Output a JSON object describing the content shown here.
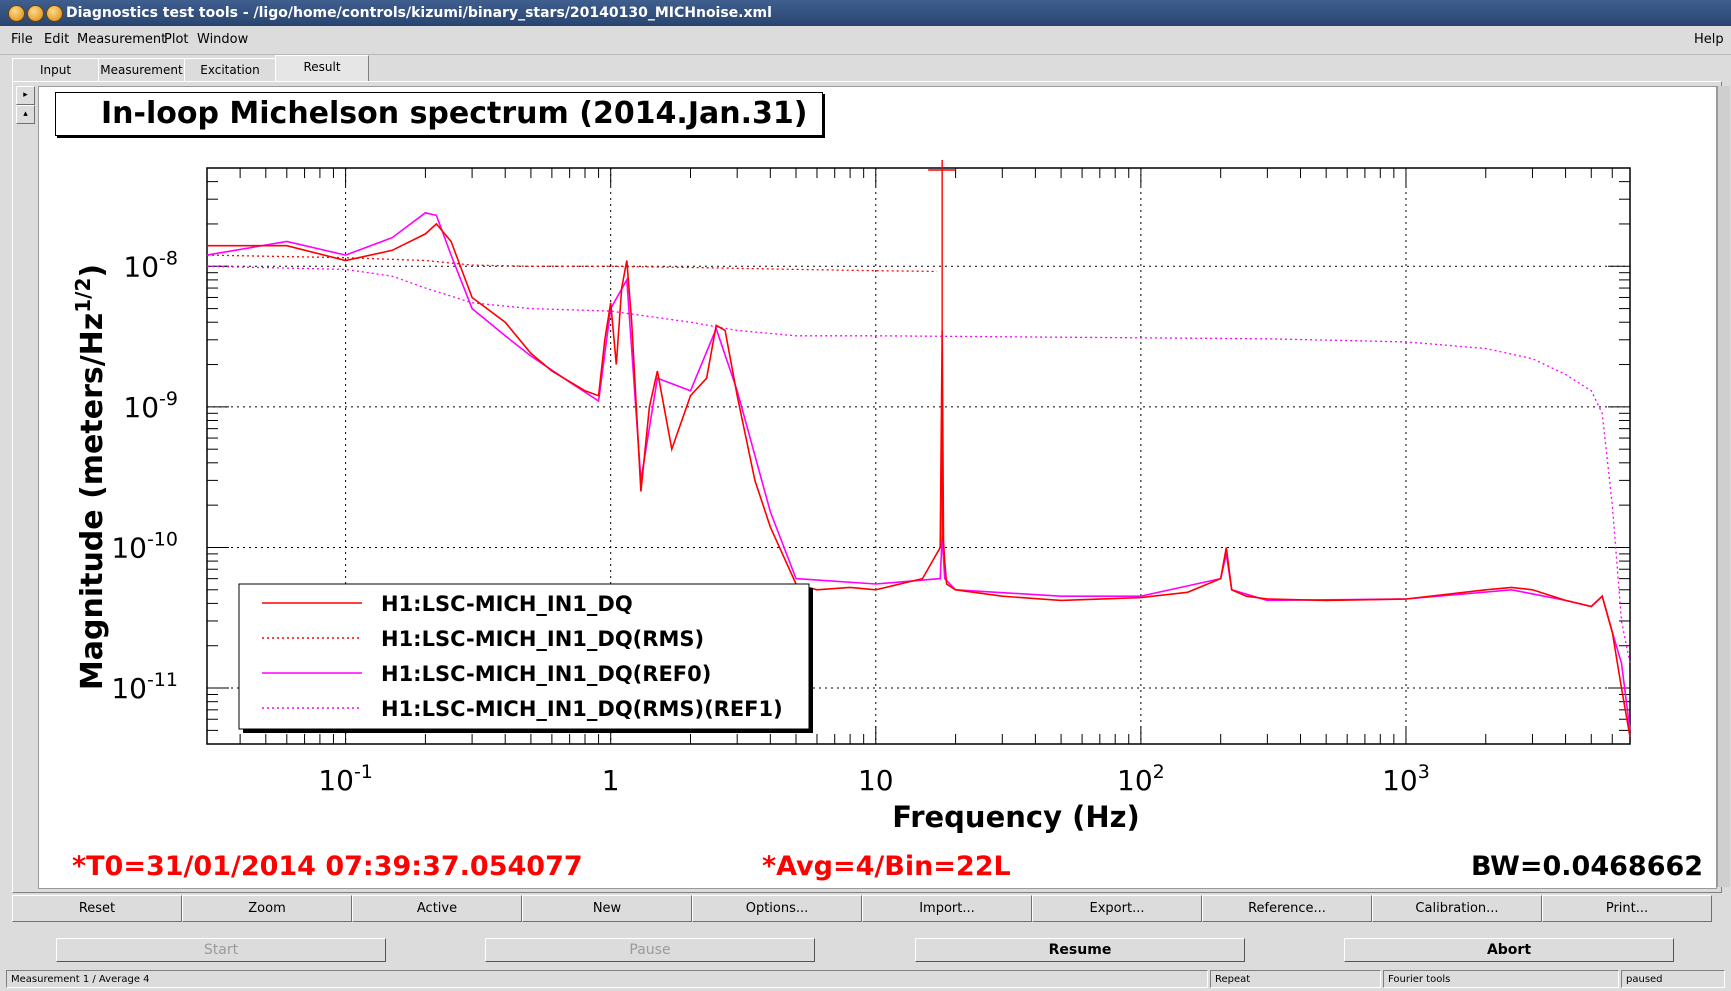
{
  "window": {
    "title": "Diagnostics test tools - /ligo/home/controls/kizumi/binary_stars/20140130_MICHnoise.xml"
  },
  "menu": {
    "file": "File",
    "edit": "Edit",
    "measurement": "Measurement",
    "plot": "Plot",
    "window": "Window",
    "help": "Help"
  },
  "tabs": [
    "Input",
    "Measurement",
    "Excitation",
    "Result"
  ],
  "sidebar": {
    "up": "▸",
    "down": "▴"
  },
  "plot": {
    "title": "In-loop Michelson spectrum (2014.Jan.31)"
  },
  "chart_data": {
    "type": "line",
    "title": "In-loop Michelson spectrum (2014.Jan.31)",
    "xlabel": "Frequency (Hz)",
    "ylabel": "Magnitude (meters/Hz^(1/2))",
    "xscale": "log",
    "yscale": "log",
    "xlim": [
      0.03,
      7000
    ],
    "ylim": [
      4e-12,
      5e-08
    ],
    "grid": true,
    "legend": "bottom-left",
    "xticks": [
      {
        "base": "10",
        "exp": "-1",
        "value": 0.1
      },
      {
        "base": "1",
        "exp": "",
        "value": 1
      },
      {
        "base": "10",
        "exp": "",
        "value": 10
      },
      {
        "base": "10",
        "exp": "2",
        "value": 100
      },
      {
        "base": "10",
        "exp": "3",
        "value": 1000
      }
    ],
    "yticks": [
      {
        "base": "10",
        "exp": "-8",
        "value": 1e-08
      },
      {
        "base": "10",
        "exp": "-9",
        "value": 1e-09
      },
      {
        "base": "10",
        "exp": "-10",
        "value": 1e-10
      },
      {
        "base": "10",
        "exp": "-11",
        "value": 1e-11
      }
    ],
    "series": [
      {
        "name": "H1:LSC-MICH_IN1_DQ",
        "color": "#ff0000",
        "dash": "solid",
        "x": [
          0.03,
          0.06,
          0.1,
          0.15,
          0.2,
          0.22,
          0.25,
          0.3,
          0.4,
          0.5,
          0.6,
          0.8,
          0.9,
          0.95,
          1.0,
          1.05,
          1.1,
          1.15,
          1.2,
          1.3,
          1.4,
          1.5,
          1.7,
          2.0,
          2.3,
          2.5,
          2.7,
          3.0,
          3.5,
          4.0,
          5.0,
          6.0,
          8.0,
          10,
          15,
          17.5,
          17.8,
          18,
          18.2,
          18.5,
          20,
          30,
          50,
          100,
          150,
          200,
          210,
          220,
          250,
          300,
          500,
          1000,
          2000,
          2500,
          3000,
          4000,
          5000,
          5500,
          6000,
          6500,
          7000
        ],
        "y": [
          1.4e-08,
          1.4e-08,
          1.1e-08,
          1.3e-08,
          1.7e-08,
          2e-08,
          1.5e-08,
          6e-09,
          4e-09,
          2.4e-09,
          1.8e-09,
          1.3e-09,
          1.2e-09,
          3e-09,
          5.5e-09,
          2e-09,
          7e-09,
          1.1e-08,
          4e-09,
          2.5e-10,
          1e-09,
          1.8e-09,
          5e-10,
          1.2e-09,
          1.6e-09,
          3.8e-09,
          3.5e-09,
          1.2e-09,
          3e-10,
          1.4e-10,
          5.5e-11,
          5e-11,
          5.2e-11,
          5e-11,
          6e-11,
          1e-10,
          3.5e-09,
          1.1e-10,
          8e-11,
          5.5e-11,
          5e-11,
          4.5e-11,
          4.2e-11,
          4.4e-11,
          4.8e-11,
          6e-11,
          1e-10,
          5e-11,
          4.5e-11,
          4.3e-11,
          4.2e-11,
          4.3e-11,
          5e-11,
          5.2e-11,
          5e-11,
          4.2e-11,
          3.8e-11,
          4.5e-11,
          2.5e-11,
          1e-11,
          4.5e-12
        ]
      },
      {
        "name": "H1:LSC-MICH_IN1_DQ(RMS)",
        "color": "#ff0000",
        "dash": "dotted",
        "x": [
          0.03,
          0.1,
          0.2,
          0.3,
          0.5,
          1.0,
          2.0,
          5.0,
          10,
          17
        ],
        "y": [
          1.2e-08,
          1.15e-08,
          1.1e-08,
          1.02e-08,
          1e-08,
          1e-08,
          9.8e-09,
          9.5e-09,
          9.3e-09,
          9.2e-09
        ]
      },
      {
        "name": "H1:LSC-MICH_IN1_DQ(REF0)",
        "color": "#ff00ff",
        "dash": "solid",
        "x": [
          0.03,
          0.06,
          0.1,
          0.15,
          0.2,
          0.22,
          0.25,
          0.3,
          0.4,
          0.5,
          0.7,
          0.9,
          1.0,
          1.15,
          1.3,
          1.5,
          2.0,
          2.5,
          3.0,
          4.0,
          5.0,
          10,
          17.5,
          17.8,
          18.2,
          20,
          50,
          100,
          200,
          210,
          220,
          300,
          1000,
          2500,
          4000,
          5000,
          5500,
          6000,
          6500,
          7000
        ],
        "y": [
          1.2e-08,
          1.5e-08,
          1.2e-08,
          1.6e-08,
          2.4e-08,
          2.3e-08,
          1.2e-08,
          5e-09,
          3.2e-09,
          2.3e-09,
          1.5e-09,
          1.1e-09,
          5e-09,
          8e-09,
          3e-10,
          1.6e-09,
          1.3e-09,
          3.6e-09,
          1.3e-09,
          1.8e-10,
          6e-11,
          5.5e-11,
          6e-11,
          1.2e-10,
          6e-11,
          5e-11,
          4.5e-11,
          4.5e-11,
          6e-11,
          9e-11,
          5e-11,
          4.2e-11,
          4.3e-11,
          5e-11,
          4.2e-11,
          3.8e-11,
          4.5e-11,
          2.5e-11,
          1.5e-11,
          5e-12
        ]
      },
      {
        "name": "H1:LSC-MICH_IN1_DQ(RMS)(REF1)",
        "color": "#ff00ff",
        "dash": "dotted",
        "x": [
          0.03,
          0.1,
          0.15,
          0.2,
          0.3,
          0.5,
          1.0,
          2.0,
          3.0,
          5.0,
          10,
          100,
          300,
          1000,
          2000,
          3000,
          4000,
          5000,
          5500,
          6000,
          6500,
          7000
        ],
        "y": [
          1e-08,
          9.5e-09,
          8.5e-09,
          7e-09,
          5.5e-09,
          5e-09,
          4.8e-09,
          4e-09,
          3.5e-09,
          3.2e-09,
          3.2e-09,
          3.1e-09,
          3.05e-09,
          2.9e-09,
          2.6e-09,
          2.2e-09,
          1.7e-09,
          1.3e-09,
          9e-10,
          2e-10,
          3e-11,
          1.5e-11
        ]
      }
    ],
    "peaks": [
      {
        "x": 17.8,
        "y": 4e-08
      }
    ]
  },
  "stats": {
    "t0": "*T0=31/01/2014 07:39:37.054077",
    "avg": "*Avg=4/Bin=22L",
    "bw": "BW=0.0468662"
  },
  "toolbar": [
    "Reset",
    "Zoom",
    "Active",
    "New",
    "Options...",
    "Import...",
    "Export...",
    "Reference...",
    "Calibration...",
    "Print..."
  ],
  "controls": {
    "start": "Start",
    "pause": "Pause",
    "resume": "Resume",
    "abort": "Abort"
  },
  "status": {
    "measurement": "Measurement 1 / Average 4",
    "repeat": "Repeat",
    "tools": "Fourier tools",
    "state": "paused"
  }
}
